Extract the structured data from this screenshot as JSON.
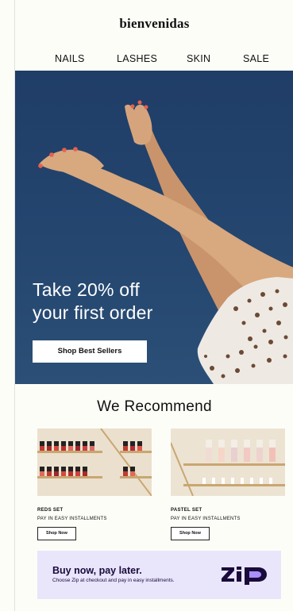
{
  "header": {
    "brand": "bienvenidas"
  },
  "nav": {
    "items": [
      "NAILS",
      "LASHES",
      "SKIN",
      "SALE"
    ]
  },
  "hero": {
    "title_line1": "Take 20% off",
    "title_line2": "your first order",
    "cta_label": "Shop Best Sellers"
  },
  "recommend": {
    "title": "We Recommend",
    "products": [
      {
        "name": "REDS SET",
        "sub": "PAY IN EASY INSTALLMENTS",
        "cta": "Shop Now"
      },
      {
        "name": "PASTEL SET",
        "sub": "PAY IN EASY INSTALLMENTS",
        "cta": "Shop Now"
      }
    ]
  },
  "zip": {
    "title": "Buy now, pay later.",
    "subtitle": "Choose Zip at checkout and pay in easy installments.",
    "logo_text": "zip",
    "logo_icon": "zip-logo-icon"
  },
  "colors": {
    "hero_bg": "#1f3d67",
    "zip_bg": "#e9e5fb",
    "zip_accent": "#aa8fff",
    "zip_text": "#1a0b3b"
  }
}
